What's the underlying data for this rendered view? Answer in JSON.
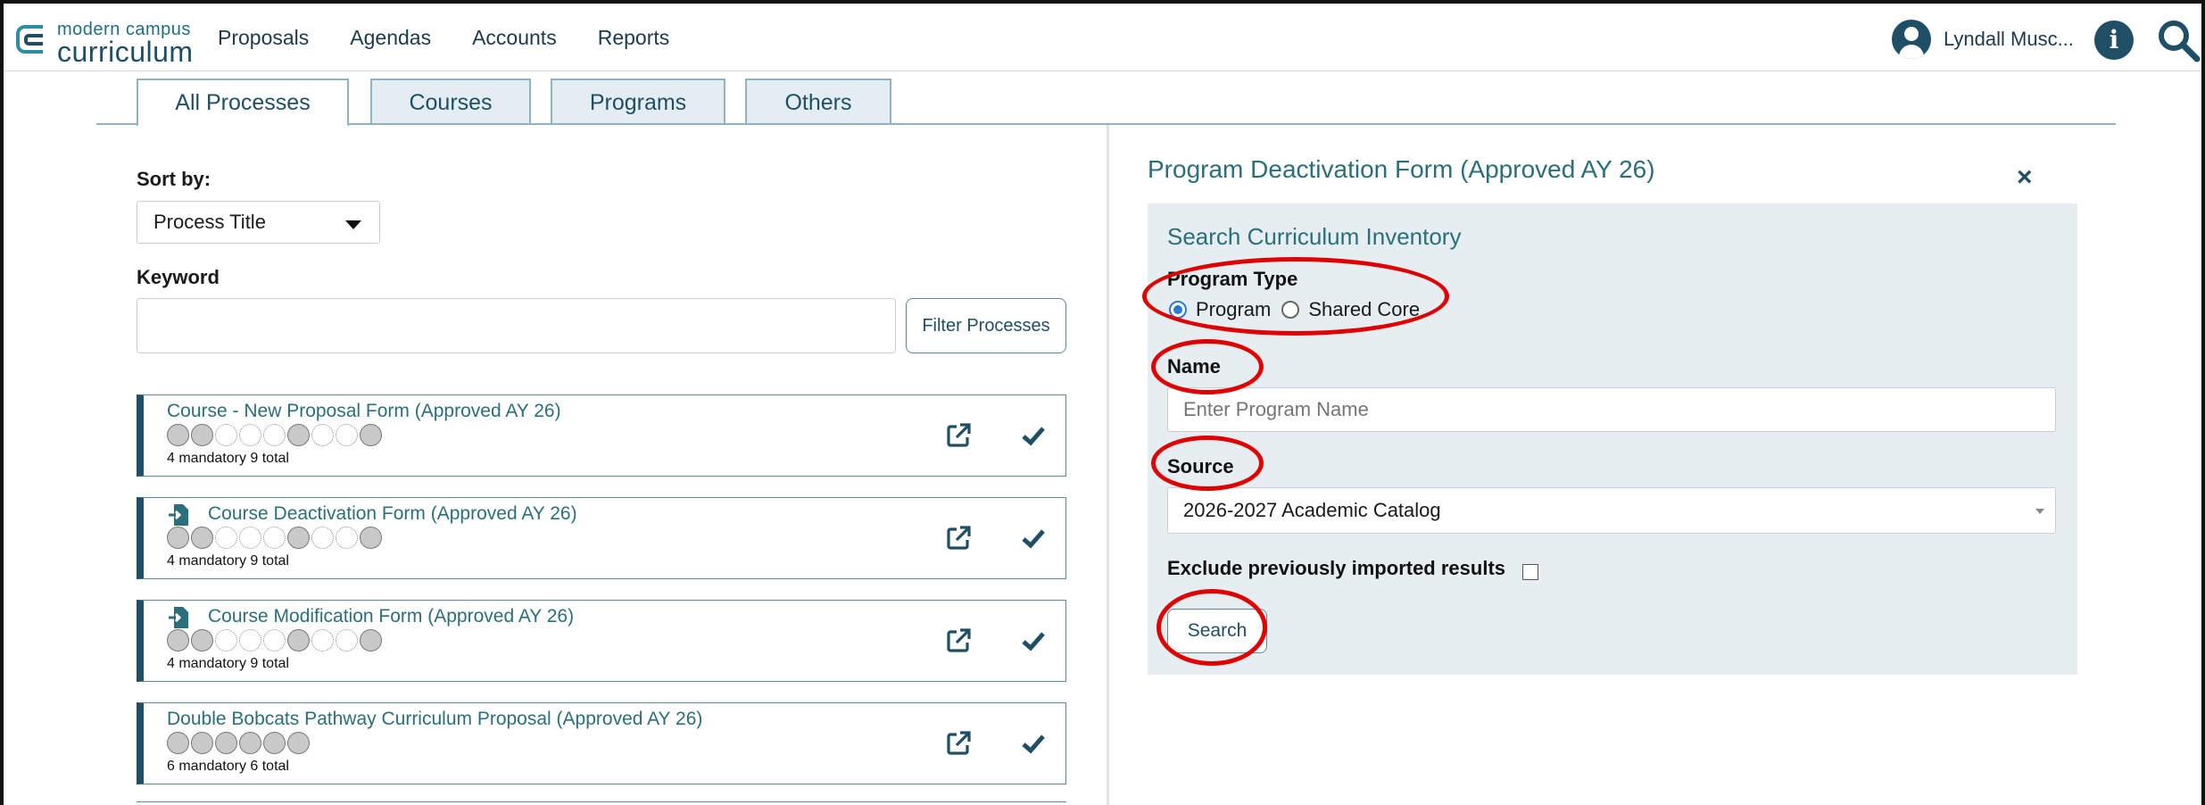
{
  "brand": {
    "top": "modern campus",
    "main": "curriculum"
  },
  "nav": {
    "items": [
      "Proposals",
      "Agendas",
      "Accounts",
      "Reports"
    ]
  },
  "user": {
    "name": "Lyndall Musc..."
  },
  "tabs": [
    "All Processes",
    "Courses",
    "Programs",
    "Others"
  ],
  "left": {
    "sort_label": "Sort by:",
    "sort_value": "Process Title",
    "keyword_label": "Keyword",
    "keyword_value": "",
    "filter_button": "Filter Processes",
    "processes": [
      {
        "title": "Course - New Proposal Form (Approved AY 26)",
        "count": "4 mandatory 9 total",
        "dots": [
          1,
          1,
          0,
          0,
          0,
          1,
          0,
          0,
          1
        ]
      },
      {
        "title": "Course Deactivation Form (Approved AY 26)",
        "count": "4 mandatory 9 total",
        "dots": [
          1,
          1,
          0,
          0,
          0,
          1,
          0,
          0,
          1
        ]
      },
      {
        "title": "Course Modification Form (Approved AY 26)",
        "count": "4 mandatory 9 total",
        "dots": [
          1,
          1,
          0,
          0,
          0,
          1,
          0,
          0,
          1
        ]
      },
      {
        "title": "Double Bobcats Pathway Curriculum Proposal (Approved AY 26)",
        "count": "6 mandatory 6 total",
        "dots": [
          1,
          1,
          1,
          1,
          1,
          1
        ]
      }
    ]
  },
  "right": {
    "form_title": "Program Deactivation Form (Approved AY 26)",
    "close": "×",
    "search_title": "Search Curriculum Inventory",
    "program_type_label": "Program Type",
    "radio_program": "Program",
    "radio_shared": "Shared Core",
    "name_label": "Name",
    "name_placeholder": "Enter Program Name",
    "source_label": "Source",
    "source_value": "2026-2027 Academic Catalog",
    "exclude_label": "Exclude previously imported results",
    "search_button": "Search"
  },
  "colors": {
    "accent": "#1f4f66",
    "link": "#2a6f7a",
    "highlight": "#e00000",
    "panel": "#e6eef1"
  }
}
